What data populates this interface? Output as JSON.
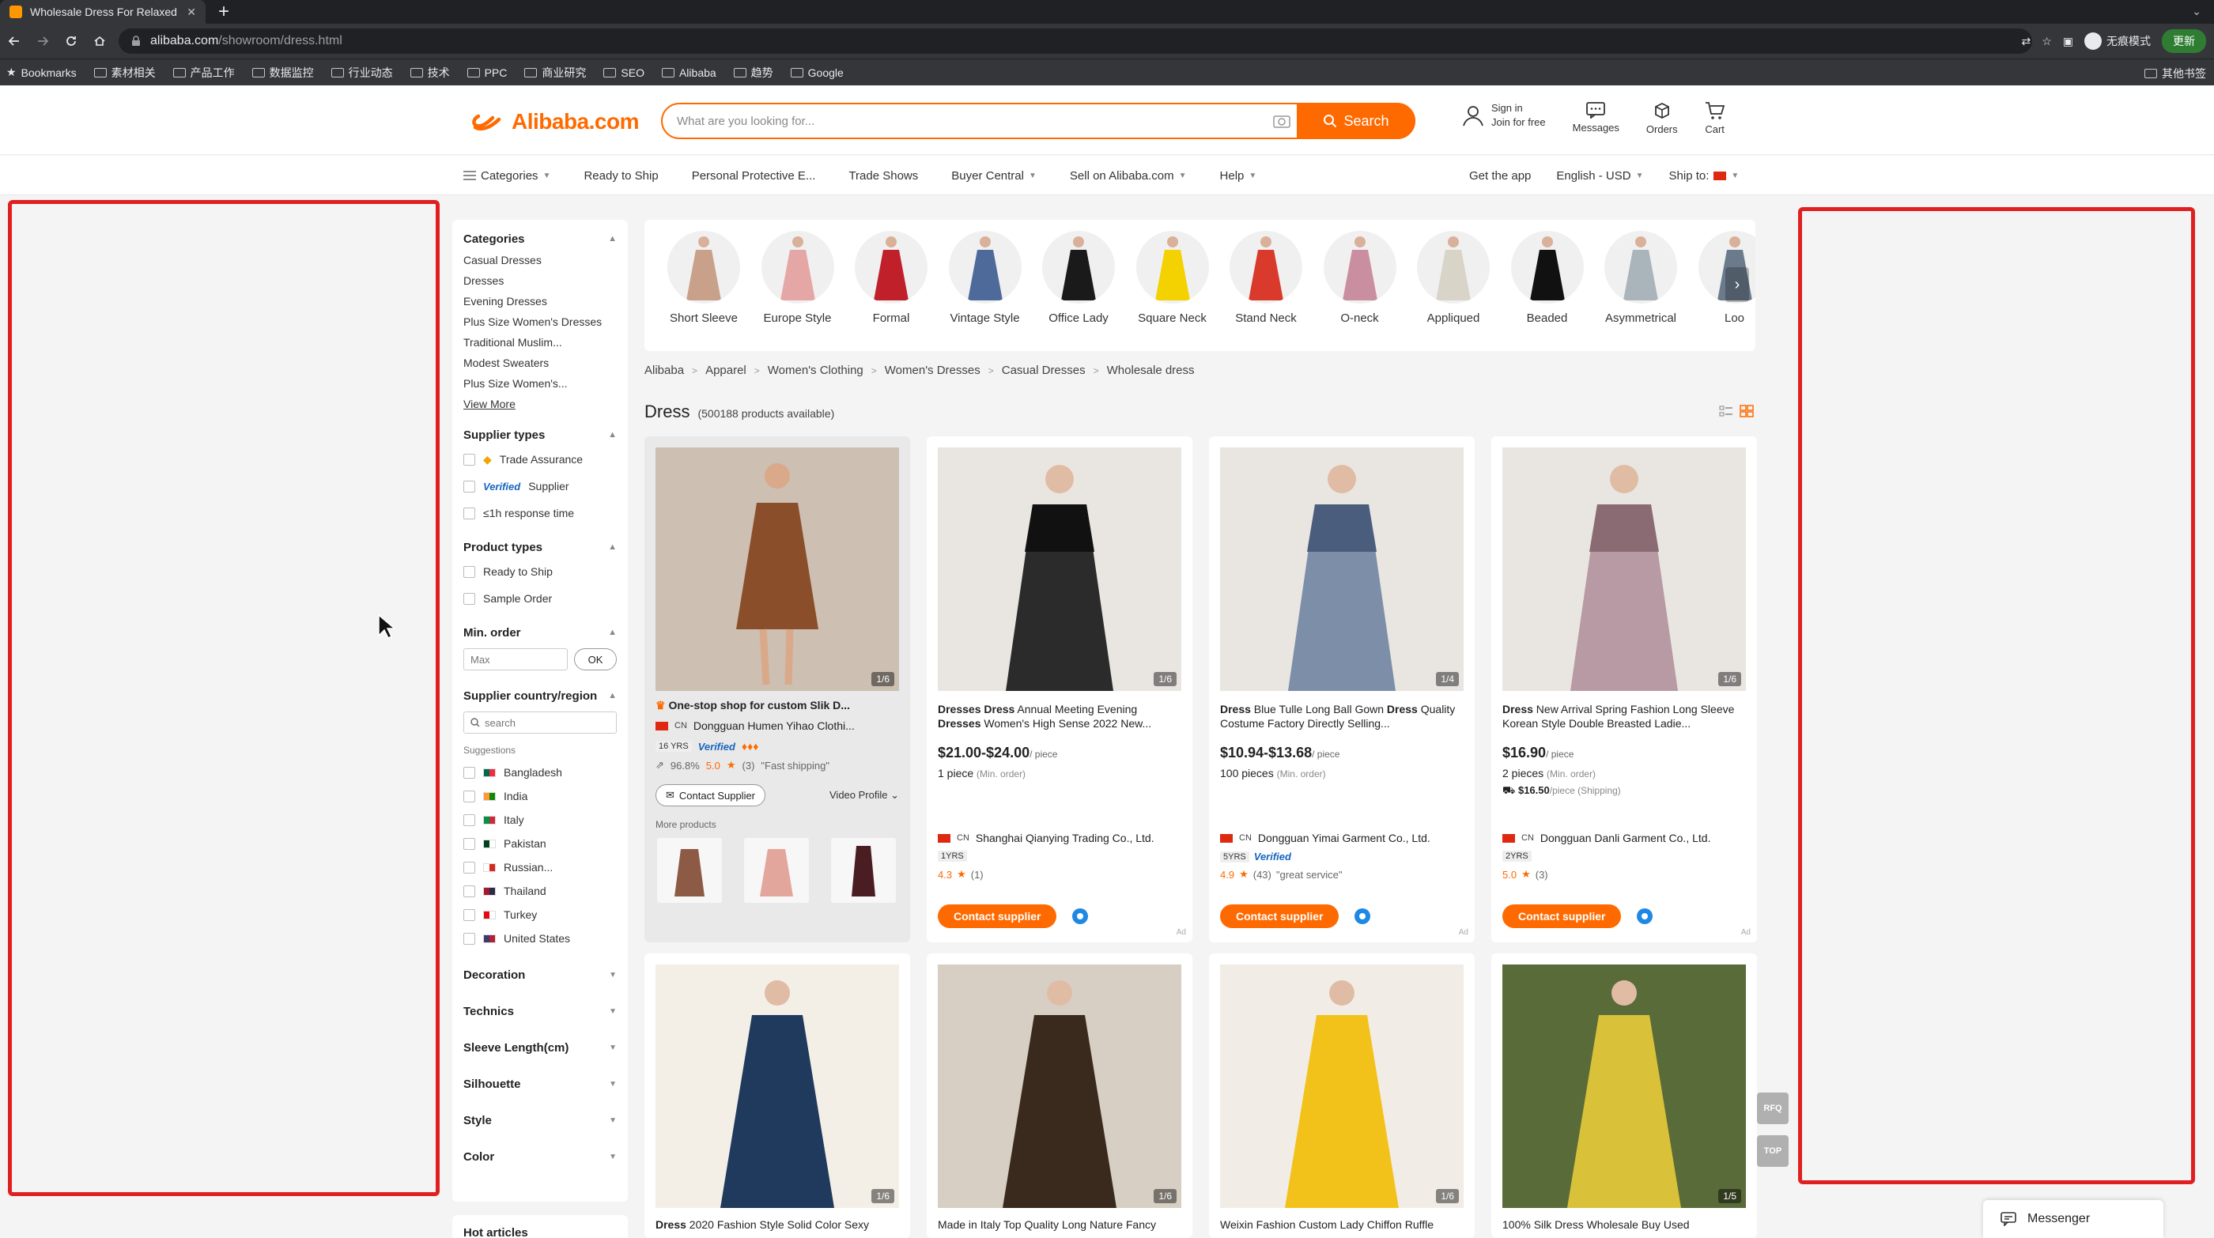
{
  "browser": {
    "tab_title": "Wholesale Dress For Relaxed A",
    "url_host": "alibaba.com",
    "url_path": "/showroom/dress.html",
    "incognito_label": "无痕模式",
    "update_label": "更新",
    "bookmarks": [
      "Bookmarks",
      "素材相关",
      "产品工作",
      "数据监控",
      "行业动态",
      "技术",
      "PPC",
      "商业研究",
      "SEO",
      "Alibaba",
      "趋势",
      "Google"
    ],
    "other_bookmarks": "其他书签"
  },
  "header": {
    "logo": "Alibaba.com",
    "search_placeholder": "What are you looking for...",
    "search_button": "Search",
    "sign_in": "Sign in",
    "join": "Join for free",
    "messages": "Messages",
    "orders": "Orders",
    "cart": "Cart"
  },
  "nav": {
    "categories": "Categories",
    "items": [
      "Ready to Ship",
      "Personal Protective E...",
      "Trade Shows",
      "Buyer Central",
      "Sell on Alibaba.com",
      "Help"
    ],
    "get_app": "Get the app",
    "language": "English - USD",
    "ship_to": "Ship to:"
  },
  "sidebar": {
    "categories_title": "Categories",
    "categories": [
      "Casual Dresses",
      "Dresses",
      "Evening Dresses",
      "Plus Size Women's Dresses",
      "Traditional Muslim...",
      "Modest Sweaters",
      "Plus Size Women's..."
    ],
    "view_more": "View More",
    "supplier_types_title": "Supplier types",
    "supplier_types": [
      "Trade Assurance",
      "Supplier",
      "≤1h response time"
    ],
    "verified_word": "Verified",
    "product_types_title": "Product types",
    "product_types": [
      "Ready to Ship",
      "Sample Order"
    ],
    "min_order_title": "Min. order",
    "min_placeholder": "Max",
    "ok": "OK",
    "country_title": "Supplier country/region",
    "country_search_placeholder": "search",
    "suggestions": "Suggestions",
    "countries": [
      "Bangladesh",
      "India",
      "Italy",
      "Pakistan",
      "Russian...",
      "Thailand",
      "Turkey",
      "United States"
    ],
    "collapsed": [
      "Decoration",
      "Technics",
      "Sleeve Length(cm)",
      "Silhouette",
      "Style",
      "Color"
    ],
    "hot_articles": "Hot articles"
  },
  "strip": {
    "items": [
      "Short Sleeve",
      "Europe Style",
      "Formal",
      "Vintage Style",
      "Office Lady",
      "Square Neck",
      "Stand Neck",
      "O-neck",
      "Appliqued",
      "Beaded",
      "Asymmetrical",
      "Loo"
    ]
  },
  "breadcrumb": [
    "Alibaba",
    "Apparel",
    "Women's Clothing",
    "Women's Dresses",
    "Casual Dresses",
    "Wholesale dress"
  ],
  "results": {
    "title": "Dress",
    "count": "(500188 products available)"
  },
  "featured": {
    "img_count": "1/6",
    "title": "One-stop shop for custom Slik D...",
    "country": "CN",
    "supplier": "Dongguan Humen Yihao Clothi...",
    "years": "16 YRS",
    "verified": "Verified",
    "rate": "96.8%",
    "score": "5.0",
    "reviews": "(3)",
    "tag": "\"Fast shipping\"",
    "contact": "Contact Supplier",
    "video": "Video Profile",
    "more_products": "More products"
  },
  "products": [
    {
      "img_count": "1/6",
      "title_bold": "Dresses Dress",
      "title_rest": " Annual Meeting Evening ",
      "title_bold2": "Dresses",
      "title_rest2": " Women's High Sense 2022 New...",
      "price": "$21.00-$24.00",
      "unit": "/ piece",
      "moq": "1 piece",
      "moq_note": "(Min. order)",
      "ship": "",
      "country": "CN",
      "supplier": "Shanghai Qianying Trading Co., Ltd.",
      "years": "1YRS",
      "verified": "",
      "score": "4.3",
      "reviews": "(1)",
      "tag": "",
      "contact": "Contact supplier",
      "ad": "Ad"
    },
    {
      "img_count": "1/4",
      "title_bold": "Dress",
      "title_rest": " Blue Tulle Long Ball Gown ",
      "title_bold2": "Dress",
      "title_rest2": " Quality Costume Factory Directly Selling...",
      "price": "$10.94-$13.68",
      "unit": "/ piece",
      "moq": "100 pieces",
      "moq_note": "(Min. order)",
      "ship": "",
      "country": "CN",
      "supplier": "Dongguan Yimai Garment Co., Ltd.",
      "years": "5YRS",
      "verified": "Verified",
      "score": "4.9",
      "reviews": "(43)",
      "tag": "\"great service\"",
      "contact": "Contact supplier",
      "ad": "Ad"
    },
    {
      "img_count": "1/6",
      "title_bold": "Dress",
      "title_rest": " New Arrival Spring Fashion Long Sleeve Korean Style Double Breasted Ladie...",
      "title_bold2": "",
      "title_rest2": "",
      "price": "$16.90",
      "unit": "/ piece",
      "moq": "2 pieces",
      "moq_note": "(Min. order)",
      "ship": "$16.50",
      "ship_note": "/piece (Shipping)",
      "country": "CN",
      "supplier": "Dongguan Danli Garment Co., Ltd.",
      "years": "2YRS",
      "verified": "",
      "score": "5.0",
      "reviews": "(3)",
      "tag": "",
      "contact": "Contact supplier",
      "ad": "Ad"
    }
  ],
  "row2": [
    {
      "img_count": "1/6",
      "title_bold": "Dress",
      "title_rest": " 2020 Fashion Style Solid Color Sexy"
    },
    {
      "img_count": "1/6",
      "title_bold": "",
      "title_rest": "Made in Italy Top Quality Long Nature Fancy"
    },
    {
      "img_count": "1/6",
      "title_bold": "",
      "title_rest": "Weixin Fashion Custom Lady Chiffon Ruffle"
    },
    {
      "img_count": "1/5",
      "title_bold": "",
      "title_rest": "100% Silk Dress Wholesale Buy Used"
    }
  ],
  "floating": {
    "rfq": "RFQ",
    "top": "TOP",
    "messenger": "Messenger"
  },
  "colors": {
    "accent": "#ff6a00",
    "annotation": "#e02020",
    "verified": "#1565c0"
  }
}
